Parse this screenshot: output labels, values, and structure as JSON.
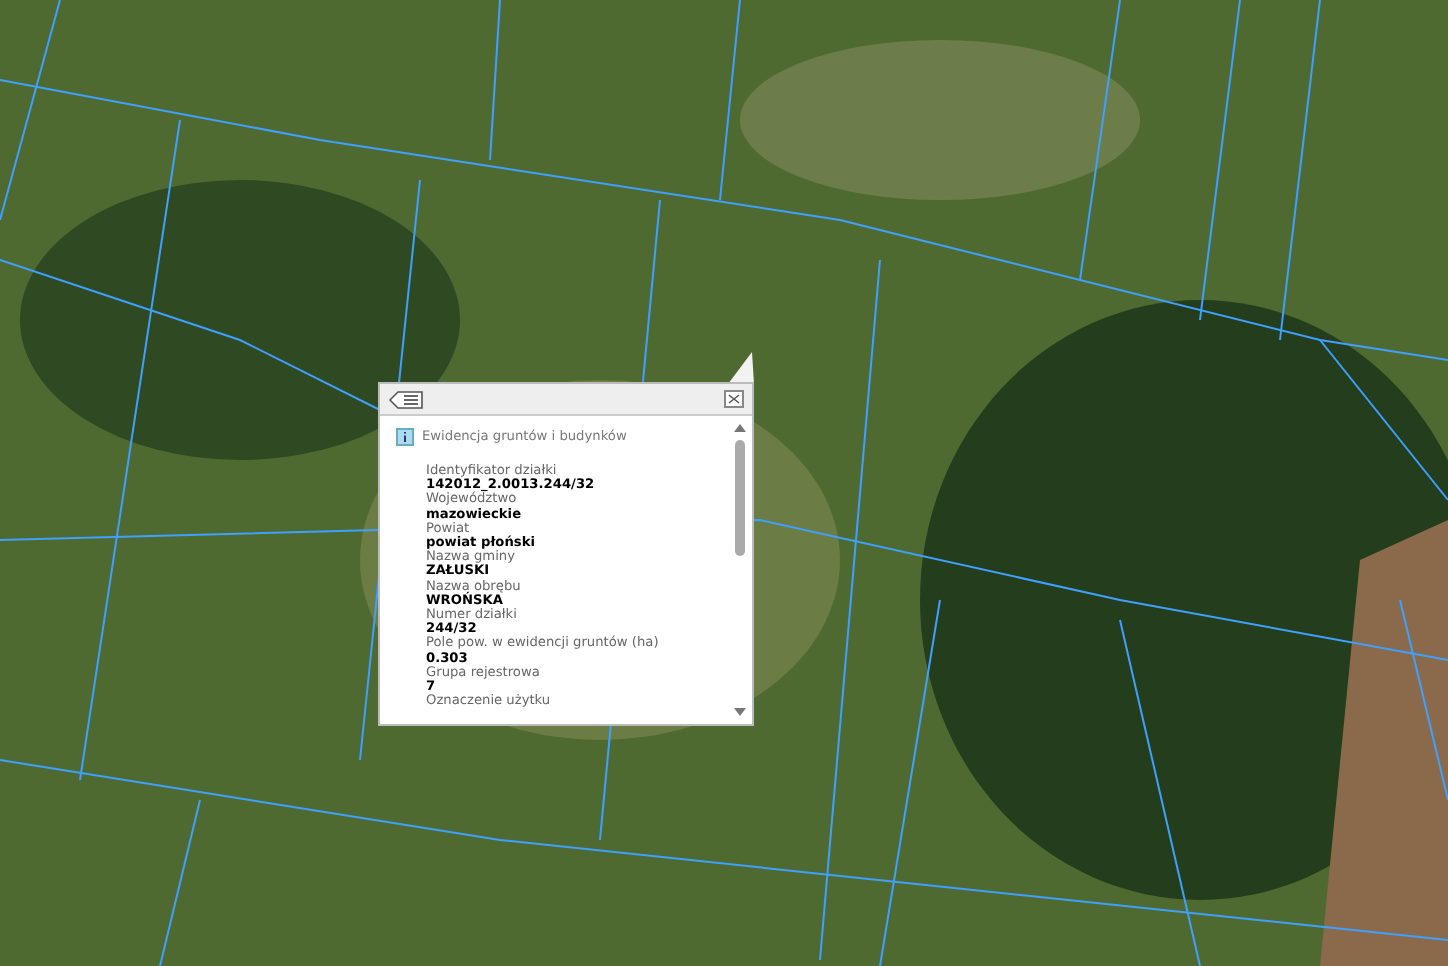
{
  "popup": {
    "source": "Ewidencja gruntów i budynków",
    "fields": [
      {
        "label": "Identyfikator działki",
        "value": "142012_2.0013.244/32"
      },
      {
        "label": "Województwo",
        "value": "mazowieckie"
      },
      {
        "label": "Powiat",
        "value": "powiat płoński"
      },
      {
        "label": "Nazwa gminy",
        "value": "ZAŁUSKI"
      },
      {
        "label": "Nazwa obrębu",
        "value": "WROŃSKA"
      },
      {
        "label": "Numer działki",
        "value": "244/32"
      },
      {
        "label": "Pole pow. w ewidencji gruntów (ha)",
        "value": "0.303"
      },
      {
        "label": "Grupa rejestrowa",
        "value": "7"
      },
      {
        "label": "Oznaczenie użytku"
      }
    ]
  }
}
